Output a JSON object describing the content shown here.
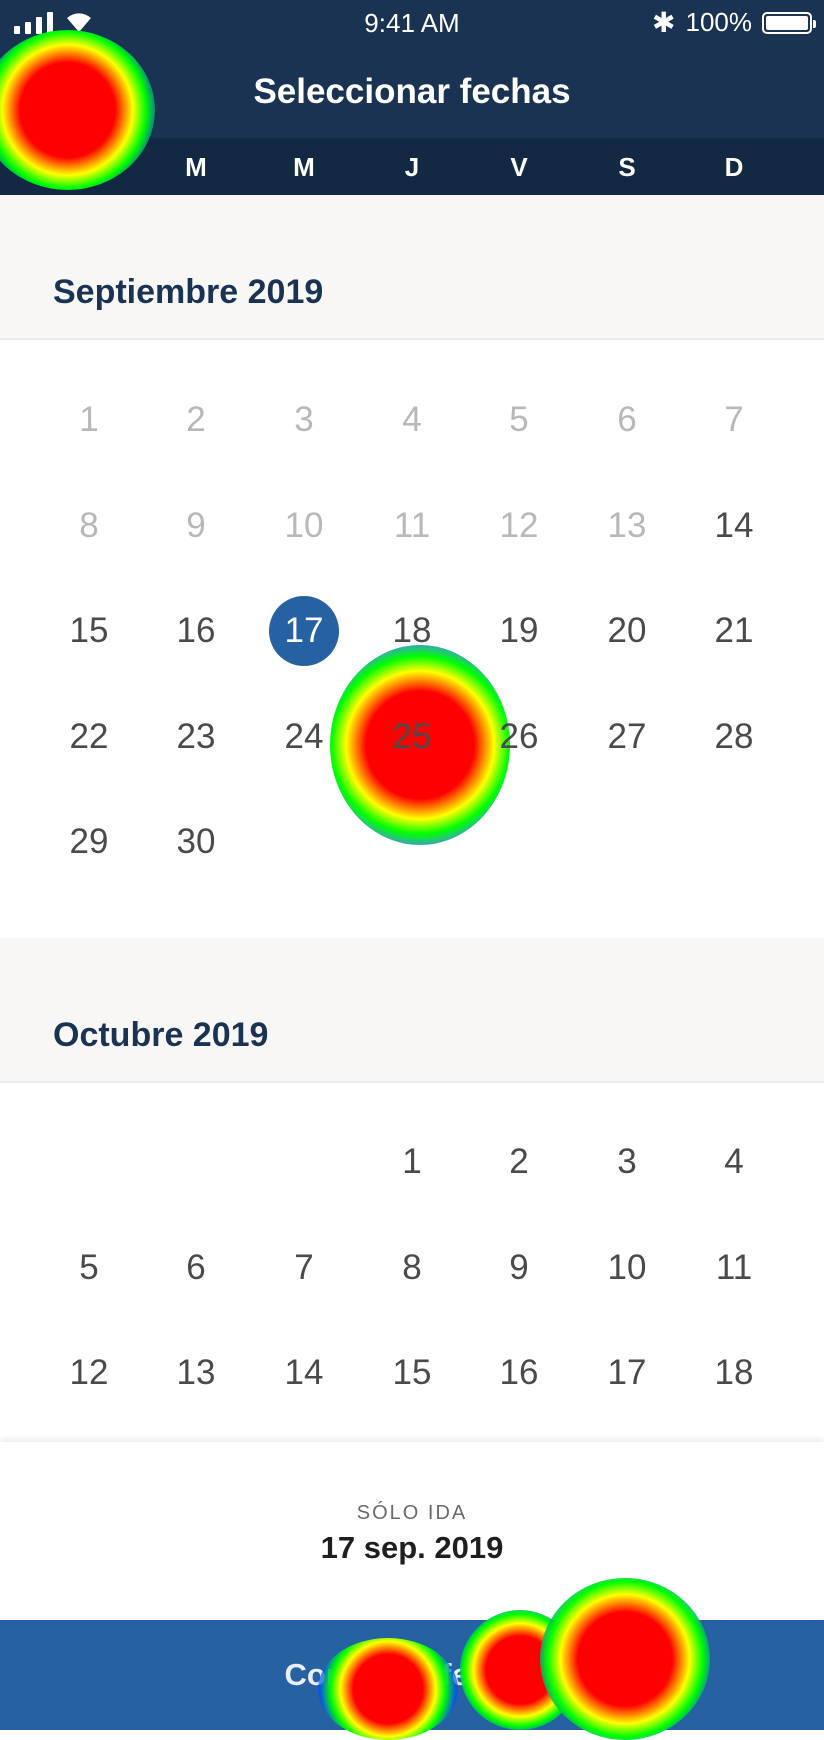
{
  "status_bar": {
    "time": "9:41 AM",
    "battery": "100%",
    "bluetooth_icon": "bluetooth-icon"
  },
  "header": {
    "title": "Seleccionar fechas",
    "weekdays": [
      "L",
      "M",
      "M",
      "J",
      "V",
      "S",
      "D"
    ]
  },
  "months": [
    {
      "title": "Septiembre 2019",
      "days": [
        {
          "label": "1",
          "state": "past"
        },
        {
          "label": "2",
          "state": "past"
        },
        {
          "label": "3",
          "state": "past"
        },
        {
          "label": "4",
          "state": "past"
        },
        {
          "label": "5",
          "state": "past"
        },
        {
          "label": "6",
          "state": "past"
        },
        {
          "label": "7",
          "state": "past"
        },
        {
          "label": "8",
          "state": "past"
        },
        {
          "label": "9",
          "state": "past"
        },
        {
          "label": "10",
          "state": "past"
        },
        {
          "label": "11",
          "state": "past"
        },
        {
          "label": "12",
          "state": "past"
        },
        {
          "label": "13",
          "state": "past"
        },
        {
          "label": "14",
          "state": "available"
        },
        {
          "label": "15",
          "state": "available"
        },
        {
          "label": "16",
          "state": "available"
        },
        {
          "label": "17",
          "state": "selected"
        },
        {
          "label": "18",
          "state": "available"
        },
        {
          "label": "19",
          "state": "available"
        },
        {
          "label": "20",
          "state": "available"
        },
        {
          "label": "21",
          "state": "available"
        },
        {
          "label": "22",
          "state": "available"
        },
        {
          "label": "23",
          "state": "available"
        },
        {
          "label": "24",
          "state": "available"
        },
        {
          "label": "25",
          "state": "available"
        },
        {
          "label": "26",
          "state": "available"
        },
        {
          "label": "27",
          "state": "available"
        },
        {
          "label": "28",
          "state": "available"
        },
        {
          "label": "29",
          "state": "available"
        },
        {
          "label": "30",
          "state": "available"
        }
      ]
    },
    {
      "title": "Octubre 2019",
      "days": [
        {
          "label": "1",
          "state": "available"
        },
        {
          "label": "2",
          "state": "available"
        },
        {
          "label": "3",
          "state": "available"
        },
        {
          "label": "4",
          "state": "available"
        },
        {
          "label": "5",
          "state": "available"
        },
        {
          "label": "6",
          "state": "available"
        },
        {
          "label": "7",
          "state": "available"
        },
        {
          "label": "8",
          "state": "available"
        },
        {
          "label": "9",
          "state": "available"
        },
        {
          "label": "10",
          "state": "available"
        },
        {
          "label": "11",
          "state": "available"
        },
        {
          "label": "12",
          "state": "available"
        },
        {
          "label": "13",
          "state": "available"
        },
        {
          "label": "14",
          "state": "available"
        },
        {
          "label": "15",
          "state": "available"
        },
        {
          "label": "16",
          "state": "available"
        },
        {
          "label": "17",
          "state": "available"
        },
        {
          "label": "18",
          "state": "available"
        }
      ]
    }
  ],
  "summary": {
    "trip_type": "SÓLO IDA",
    "date": "17 sep. 2019",
    "confirm_label": "Confirmar fechas"
  },
  "colors": {
    "header": "#1b3353",
    "accent": "#2661a2",
    "past_day": "#b8b8b8",
    "day": "#4a4a4a"
  }
}
